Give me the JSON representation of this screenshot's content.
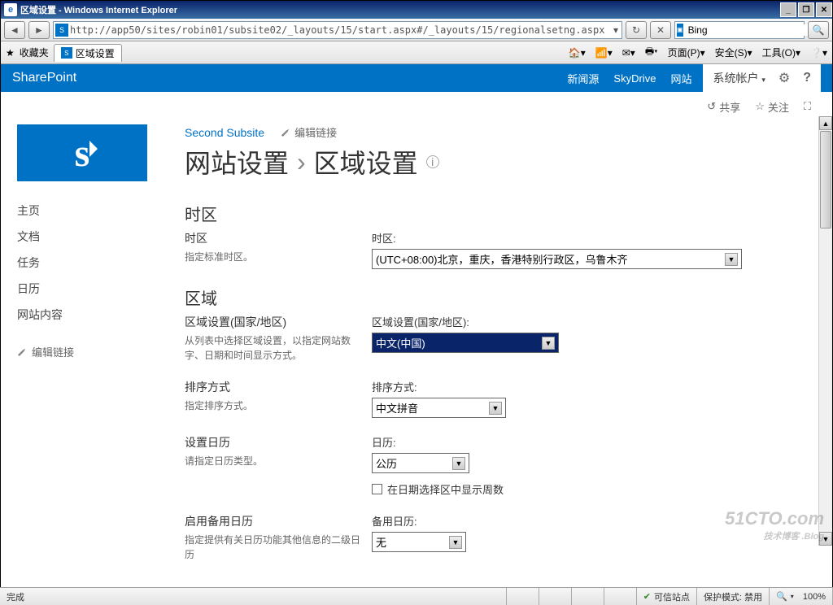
{
  "window": {
    "title": "区域设置 - Windows Internet Explorer",
    "url": "http://app50/sites/robin01/subsite02/_layouts/15/start.aspx#/_layouts/15/regionalsetng.aspx",
    "search_engine": "Bing"
  },
  "favorites_label": "收藏夹",
  "tab_title": "区域设置",
  "ie_commands": {
    "page": "页面(P)",
    "safety": "安全(S)",
    "tools": "工具(O)"
  },
  "suite": {
    "brand": "SharePoint",
    "links": [
      "新闻源",
      "SkyDrive",
      "网站"
    ],
    "account": "系统帐户"
  },
  "page_actions": {
    "share": "共享",
    "follow": "关注"
  },
  "breadcrumb": {
    "subsite": "Second Subsite",
    "edit_links": "编辑链接"
  },
  "page_title": {
    "part1": "网站设置",
    "part2": "区域设置"
  },
  "left_nav": {
    "items": [
      "主页",
      "文档",
      "任务",
      "日历",
      "网站内容"
    ],
    "edit_links": "编辑链接"
  },
  "sections": {
    "timezone": {
      "heading": "时区",
      "sub": "时区",
      "desc": "指定标准时区。",
      "field_label": "时区:",
      "value": "(UTC+08:00)北京，重庆，香港特别行政区，乌鲁木齐"
    },
    "region": {
      "heading": "区域",
      "sub": "区域设置(国家/地区)",
      "desc": "从列表中选择区域设置，以指定网站数字、日期和时间显示方式。",
      "field_label": "区域设置(国家/地区):",
      "value": "中文(中国)"
    },
    "sort": {
      "sub": "排序方式",
      "desc": "指定排序方式。",
      "field_label": "排序方式:",
      "value": "中文拼音"
    },
    "calendar": {
      "sub": "设置日历",
      "desc": "请指定日历类型。",
      "field_label": "日历:",
      "value": "公历",
      "checkbox_label": "在日期选择区中显示周数"
    },
    "alt_calendar": {
      "sub": "启用备用日历",
      "desc": "指定提供有关日历功能其他信息的二级日历",
      "field_label": "备用日历:",
      "value": "无"
    }
  },
  "statusbar": {
    "done": "完成",
    "trusted": "可信站点",
    "protected": "保护模式: 禁用",
    "zoom": "100%"
  },
  "watermark": {
    "main": "51CTO.com",
    "sub": "技术博客 .Blog"
  }
}
